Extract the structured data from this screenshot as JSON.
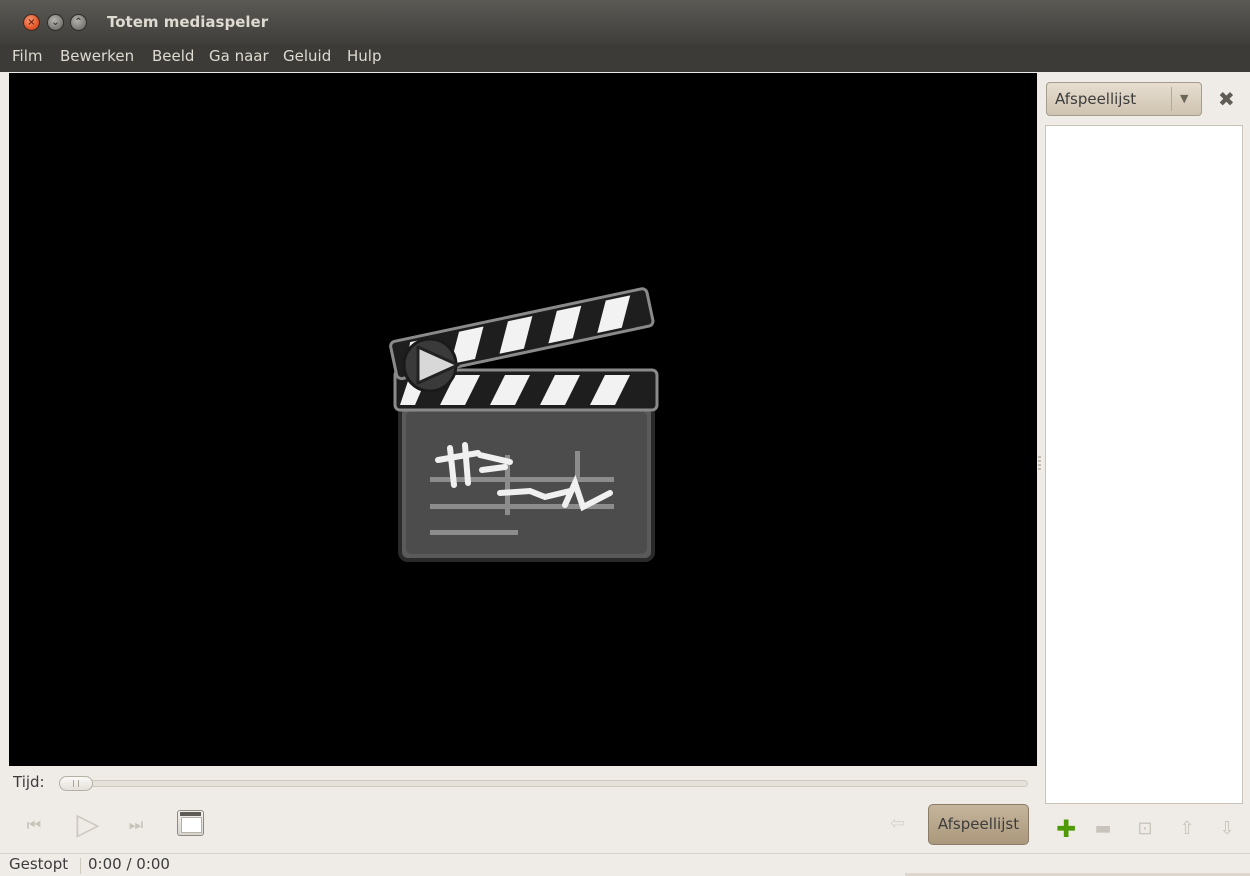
{
  "window": {
    "title": "Totem mediaspeler",
    "buttons": [
      "close",
      "minimize",
      "maximize"
    ]
  },
  "menubar": {
    "items": [
      "Film",
      "Bewerken",
      "Beeld",
      "Ga naar",
      "Geluid",
      "Hulp"
    ]
  },
  "video": {
    "logo_icon": "clapperboard-icon"
  },
  "sidebar": {
    "selector_value": "Afspeellijst",
    "close_icon": "close-icon",
    "playlist_items": [],
    "toolbar_icons": [
      "add-icon",
      "remove-icon",
      "save-icon",
      "move-up-icon",
      "move-down-icon"
    ]
  },
  "controls": {
    "time_label": "Tijd:",
    "seek_fraction": 0.0,
    "buttons": [
      "previous-icon",
      "play-icon",
      "next-icon",
      "fullscreen-icon"
    ],
    "sidebar_toggle_label": "Afspeellijst"
  },
  "status": {
    "state": "Gestopt",
    "time": "0:00 / 0:00"
  },
  "colors": {
    "titlebar": "#4a4945",
    "video_bg": "#000000",
    "window_bg": "#efebe7",
    "accent_button": "#b8a78b"
  }
}
